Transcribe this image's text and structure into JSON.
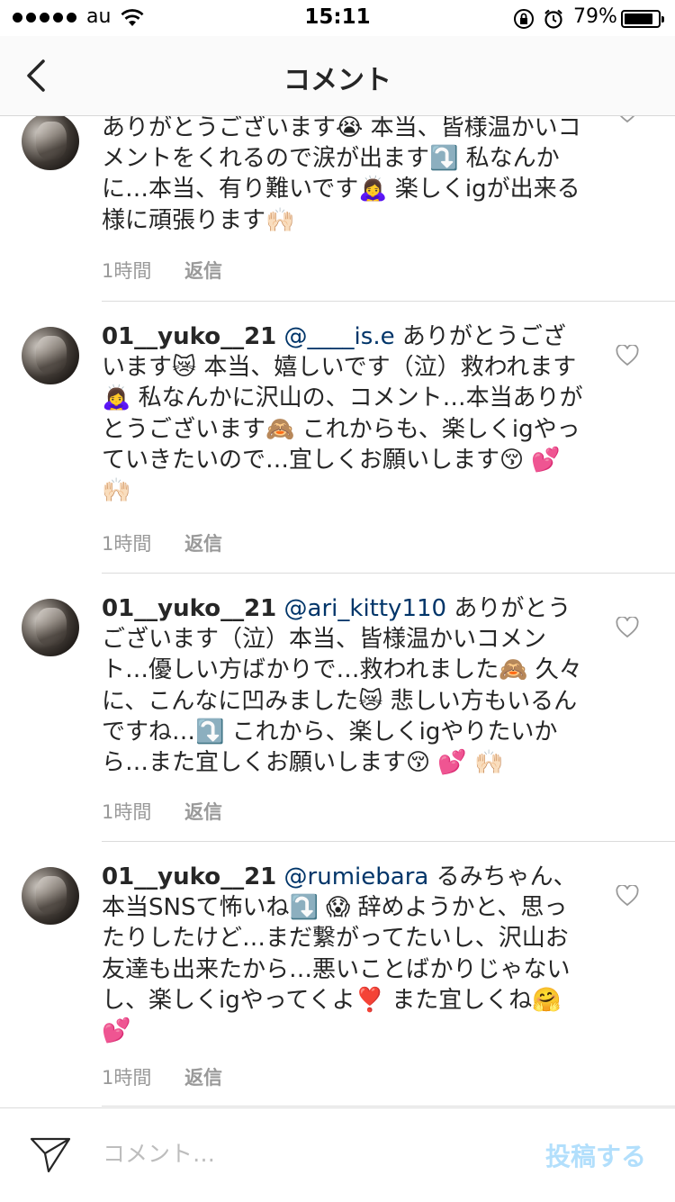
{
  "status_bar": {
    "carrier": "au",
    "time": "15:11",
    "battery": "79%",
    "battery_level": 0.79,
    "icons": [
      "signal-dots",
      "wifi-icon",
      "rotation-lock-icon",
      "alarm-icon",
      "battery-icon"
    ]
  },
  "nav": {
    "title": "コメント",
    "back_icon": "chevron-left-icon"
  },
  "comments": [
    {
      "username": "",
      "mention": "",
      "text": "ありがとうございます😭 本当、皆様温かいコメントをくれるので涙が出ます⤵️ 私なんかに…本当、有り難いです🙇‍♀️ 楽しくigが出来る様に頑張ります🙌🏻",
      "time": "1時間",
      "reply": "返信"
    },
    {
      "username": "01__yuko__21",
      "mention": "@____is.e",
      "text": "ありがとうございます😿 本当、嬉しいです（泣）救われます🙇‍♀️ 私なんかに沢山の、コメント…本当ありがとうございます🙈 これからも、楽しくigやっていきたいので…宜しくお願いします😚 💕 🙌🏻",
      "time": "1時間",
      "reply": "返信"
    },
    {
      "username": "01__yuko__21",
      "mention": "@ari_kitty110",
      "text": "ありがとうございます（泣）本当、皆様温かいコメント…優しい方ばかりで…救われました🙈 久々に、こんなに凹みました😿 悲しい方もいるんですね…⤵️ これから、楽しくigやりたいから…また宜しくお願いします😚 💕 🙌🏻",
      "time": "1時間",
      "reply": "返信"
    },
    {
      "username": "01__yuko__21",
      "mention": "@rumiebara",
      "text": "るみちゃん、本当SNSて怖いね⤵️ 😱 辞めようかと、思ったりしたけど…まだ繋がってたいし、沢山お友達も出来たから…悪いことばかりじゃないし、楽しくigやってくよ❣️ また宜しくね🤗 💕",
      "time": "1時間",
      "reply": "返信"
    }
  ],
  "composer": {
    "placeholder": "コメント…",
    "post_label": "投稿する",
    "send_icon": "paper-plane-icon"
  },
  "colors": {
    "mention": "#003569",
    "post_button": "#b2dffc",
    "meta": "#999999"
  }
}
